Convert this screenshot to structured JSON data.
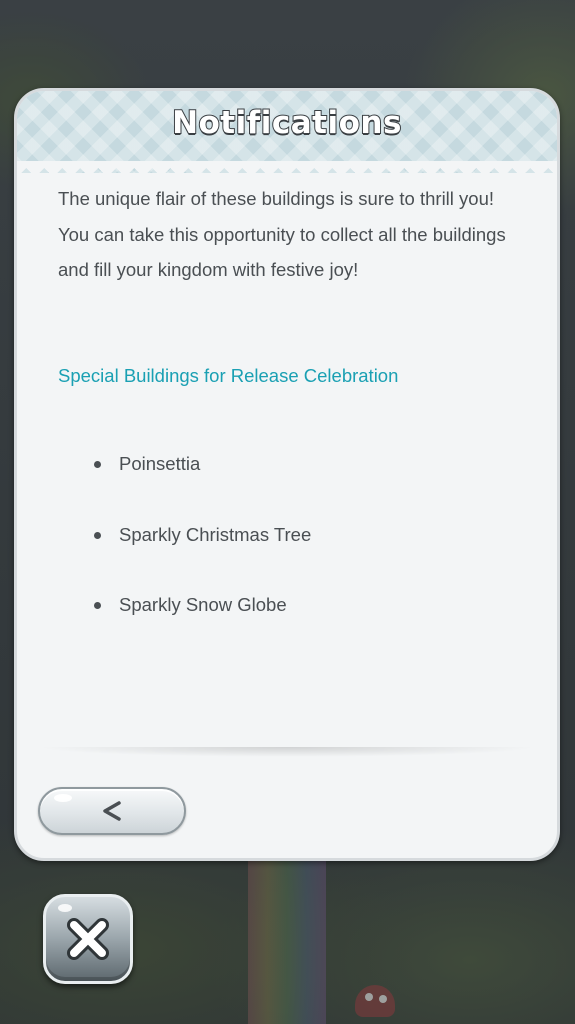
{
  "dialog": {
    "title": "Notifications",
    "body_paragraphs": [
      "The unique flair of these buildings is sure to thrill you!",
      "You can take this opportunity to collect all the buildings and fill your kingdom with festive joy!"
    ],
    "section_link": "Special Buildings for Release Celebration",
    "buildings": [
      "Poinsettia",
      "Sparkly Christmas Tree",
      "Sparkly Snow Globe"
    ]
  },
  "controls": {
    "back_icon": "back-chevron-icon",
    "close_icon": "close-x-icon"
  },
  "colors": {
    "header_bg": "#c5d9df",
    "panel_bg": "#f3f5f6",
    "body_text": "#4a4f53",
    "link_text": "#1aa0b3",
    "title_outline": "#3a3f43"
  }
}
